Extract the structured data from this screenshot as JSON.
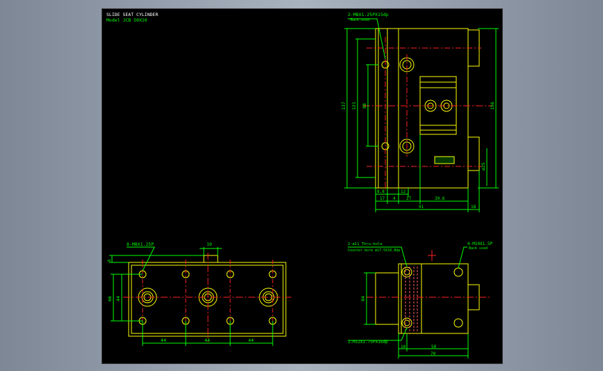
{
  "colors": {
    "background": "#8e98a6",
    "sheet": "#000000",
    "outline": "#ffff00",
    "dimension": "#00ff00",
    "centerline": "#ff2020",
    "title": "#ffffff",
    "model": "#00ff00",
    "hidden": "#ff6060"
  },
  "title": {
    "name": "SLIDE SEAT CYLINDER",
    "model": "Model  JCB 50X10"
  },
  "side_view": {
    "callout_tap": "2-M8X1.25PX15dp",
    "callout_tap_sub": "Back used",
    "dims_left": [
      "137",
      "121",
      "88"
    ],
    "dim_right": "156",
    "dim_bore": "ø25",
    "dims_bottom_row1": [
      "8.8",
      "12"
    ],
    "dims_bottom_row2": [
      "17",
      "4",
      "27",
      "39.6"
    ],
    "dims_bottom_row3": [
      "91",
      "18"
    ]
  },
  "plan_view": {
    "callout_tap": "8-M8X1.25P",
    "dim_top": "19",
    "dim_left_small": "6",
    "dims_left": [
      "66",
      "44"
    ],
    "dims_bottom": [
      "44",
      "44",
      "44"
    ]
  },
  "end_view": {
    "callout_hole": "2-ø11 Thru-hole",
    "callout_cbore": "Counter bore  ø17.5X10.8dp",
    "callout_tap": "4-M10X1.5P",
    "callout_tap_sub": "Back used",
    "callout_bottom": "2-M12X1.75PX16dp",
    "dim_left": "84",
    "dims_bottom": [
      "10",
      "50",
      "70"
    ]
  }
}
